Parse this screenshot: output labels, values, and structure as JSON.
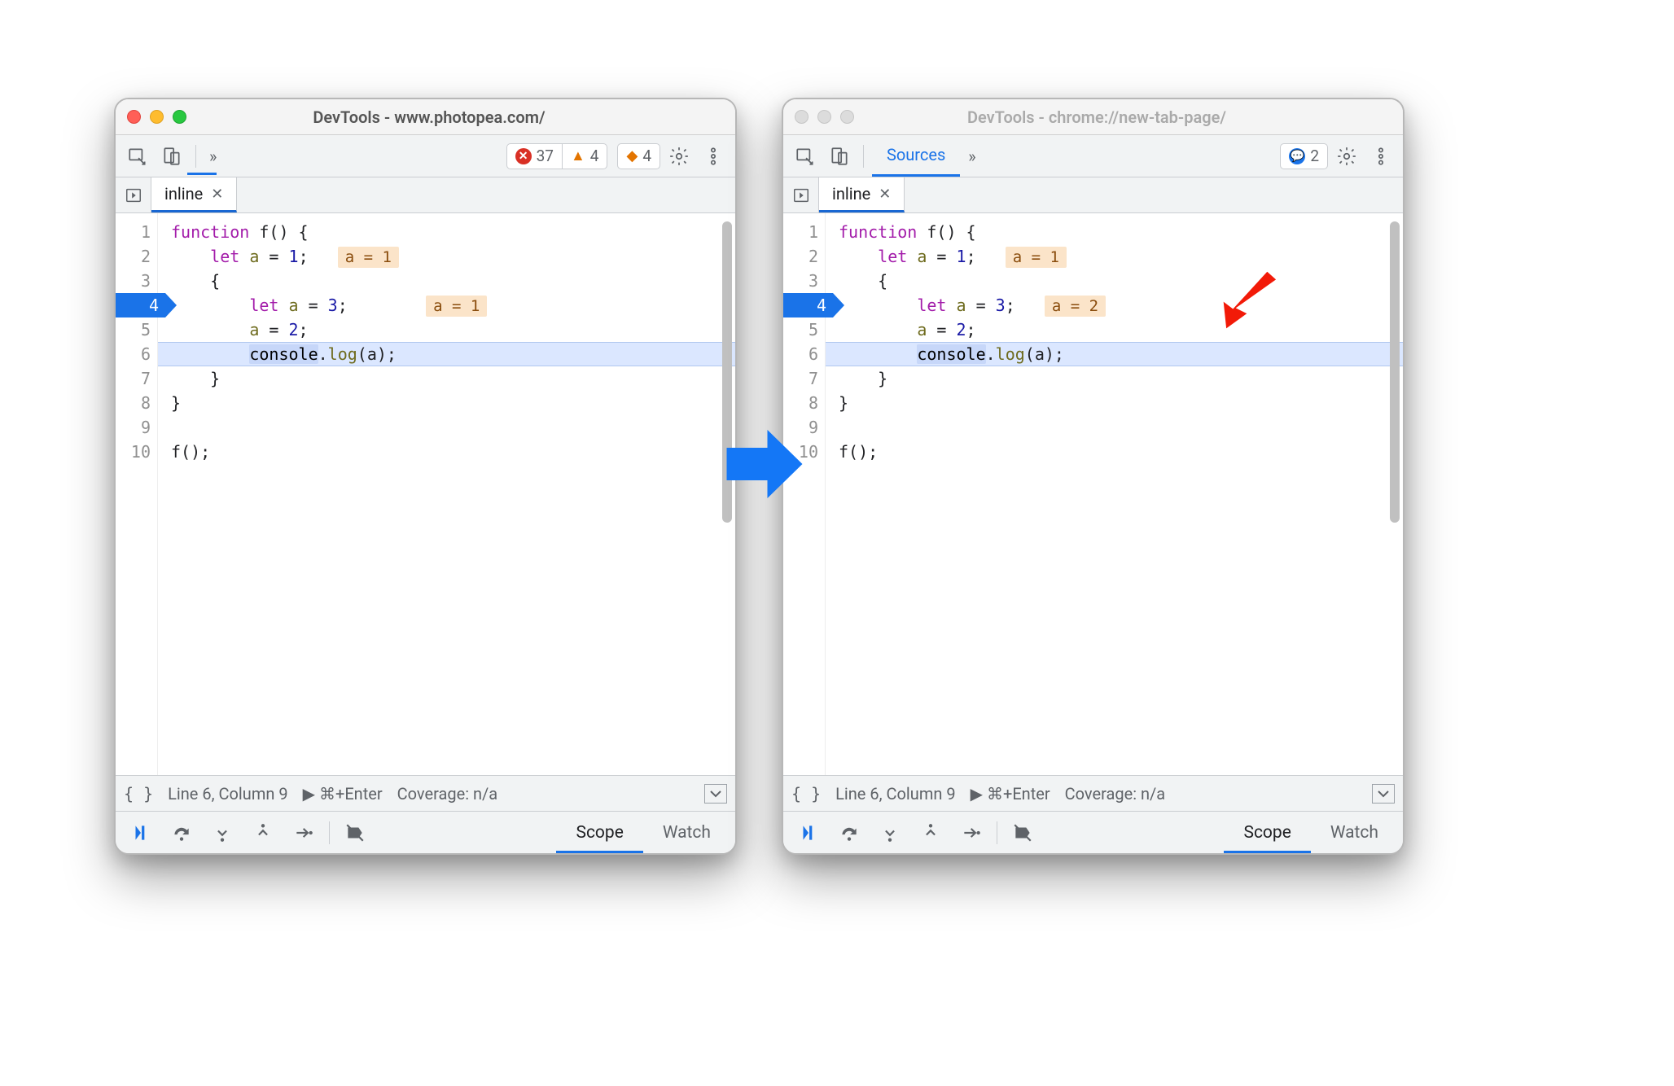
{
  "windows": [
    {
      "title": "DevTools - www.photopea.com/",
      "active": true,
      "toolbar": {
        "tabs_overflow": "»",
        "sources_tab": null,
        "errors": "37",
        "warnings": "4",
        "issues": "4",
        "messages": null
      },
      "tab": {
        "name": "inline"
      },
      "code": {
        "execution_line": 4,
        "highlighted_line": 6,
        "lines": [
          "1",
          "2",
          "3",
          "4",
          "5",
          "6",
          "7",
          "8",
          "9",
          "10"
        ],
        "hints": {
          "line2": "a = 1",
          "line4": "a = 1"
        }
      },
      "status": {
        "pos": "Line 6, Column 9",
        "shortcut": "⌘+Enter",
        "coverage": "Coverage: n/a"
      },
      "panes": {
        "scope": "Scope",
        "watch": "Watch"
      },
      "red_arrow": false
    },
    {
      "title": "DevTools - chrome://new-tab-page/",
      "active": false,
      "toolbar": {
        "tabs_overflow": "»",
        "sources_tab": "Sources",
        "errors": null,
        "warnings": null,
        "issues": null,
        "messages": "2"
      },
      "tab": {
        "name": "inline"
      },
      "code": {
        "execution_line": 4,
        "highlighted_line": 6,
        "lines": [
          "1",
          "2",
          "3",
          "4",
          "5",
          "6",
          "7",
          "8",
          "9",
          "10"
        ],
        "hints": {
          "line2": "a = 1",
          "line4": "a = 2"
        }
      },
      "status": {
        "pos": "Line 6, Column 9",
        "shortcut": "⌘+Enter",
        "coverage": "Coverage: n/a"
      },
      "panes": {
        "scope": "Scope",
        "watch": "Watch"
      },
      "red_arrow": true
    }
  ],
  "source_code": {
    "k_function": "function",
    "fn": "f",
    "paren_open": "()",
    "brace_open": "{",
    "k_let": "let",
    "var_a": "a",
    "eq": " = ",
    "n1": "1",
    "semi": ";",
    "brace_open2": "{",
    "n3": "3",
    "n2": "2",
    "console": "console",
    "dot": ".",
    "log": "log",
    "call_a": "(a);",
    "brace_close": "}",
    "call_f": "f();"
  },
  "labels": {
    "pretty_print": "{ }",
    "play_prefix": "▶"
  }
}
